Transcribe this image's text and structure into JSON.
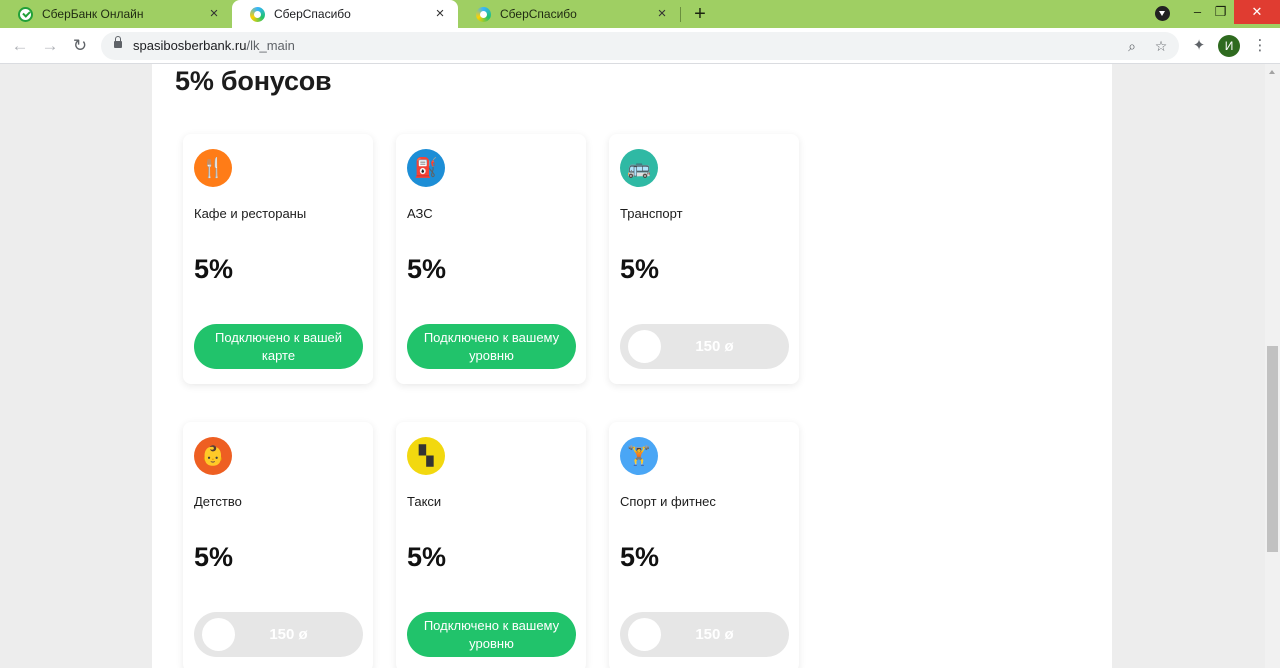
{
  "browser": {
    "tabs": [
      {
        "title": "СберБанк Онлайн",
        "active": false,
        "favicon": "sber-icon"
      },
      {
        "title": "СберСпасибо",
        "active": true,
        "favicon": "spasibo-icon"
      },
      {
        "title": "СберСпасибо",
        "active": false,
        "favicon": "spasibo-icon"
      }
    ],
    "tab_close_glyph": "×",
    "new_tab_glyph": "+",
    "window": {
      "minimize": "–",
      "restore": "❐",
      "close": "✕"
    },
    "url": {
      "host": "spasibosberbank.ru",
      "path": "/lk_main"
    },
    "profile_initial": "И",
    "colors": {
      "tabstrip": "#9fcf63",
      "profile": "#2e6a1f"
    }
  },
  "page": {
    "title": "5% бонусов",
    "categories": [
      {
        "name": "Кафе и рестораны",
        "percent": "5%",
        "icon": "fork-knife-icon",
        "icon_glyph": "🍴",
        "icon_color": "#ff7c17",
        "status": "connected",
        "button_label": "Подключено к вашей карте"
      },
      {
        "name": "АЗС",
        "percent": "5%",
        "icon": "fuel-pump-icon",
        "icon_glyph": "⛽",
        "icon_color": "#1d8ed6",
        "status": "connected",
        "button_label": "Подключено к вашему уровню"
      },
      {
        "name": "Транспорт",
        "percent": "5%",
        "icon": "bus-icon",
        "icon_glyph": "🚌",
        "icon_color": "#2fb9a4",
        "status": "available",
        "cost": "150 ø"
      },
      {
        "name": "Детство",
        "percent": "5%",
        "icon": "stroller-icon",
        "icon_glyph": "👶",
        "icon_color": "#ee5f22",
        "status": "available",
        "cost": "150 ø"
      },
      {
        "name": "Такси",
        "percent": "5%",
        "icon": "taxi-checker-icon",
        "icon_glyph": "▚",
        "icon_color": "#f2d80f",
        "status": "connected",
        "button_label": "Подключено к вашему уровню"
      },
      {
        "name": "Спорт и фитнес",
        "percent": "5%",
        "icon": "dumbbell-icon",
        "icon_glyph": "🏋",
        "icon_color": "#4aa6f5",
        "status": "available",
        "cost": "150 ø"
      }
    ],
    "accent_color": "#21c36b"
  }
}
